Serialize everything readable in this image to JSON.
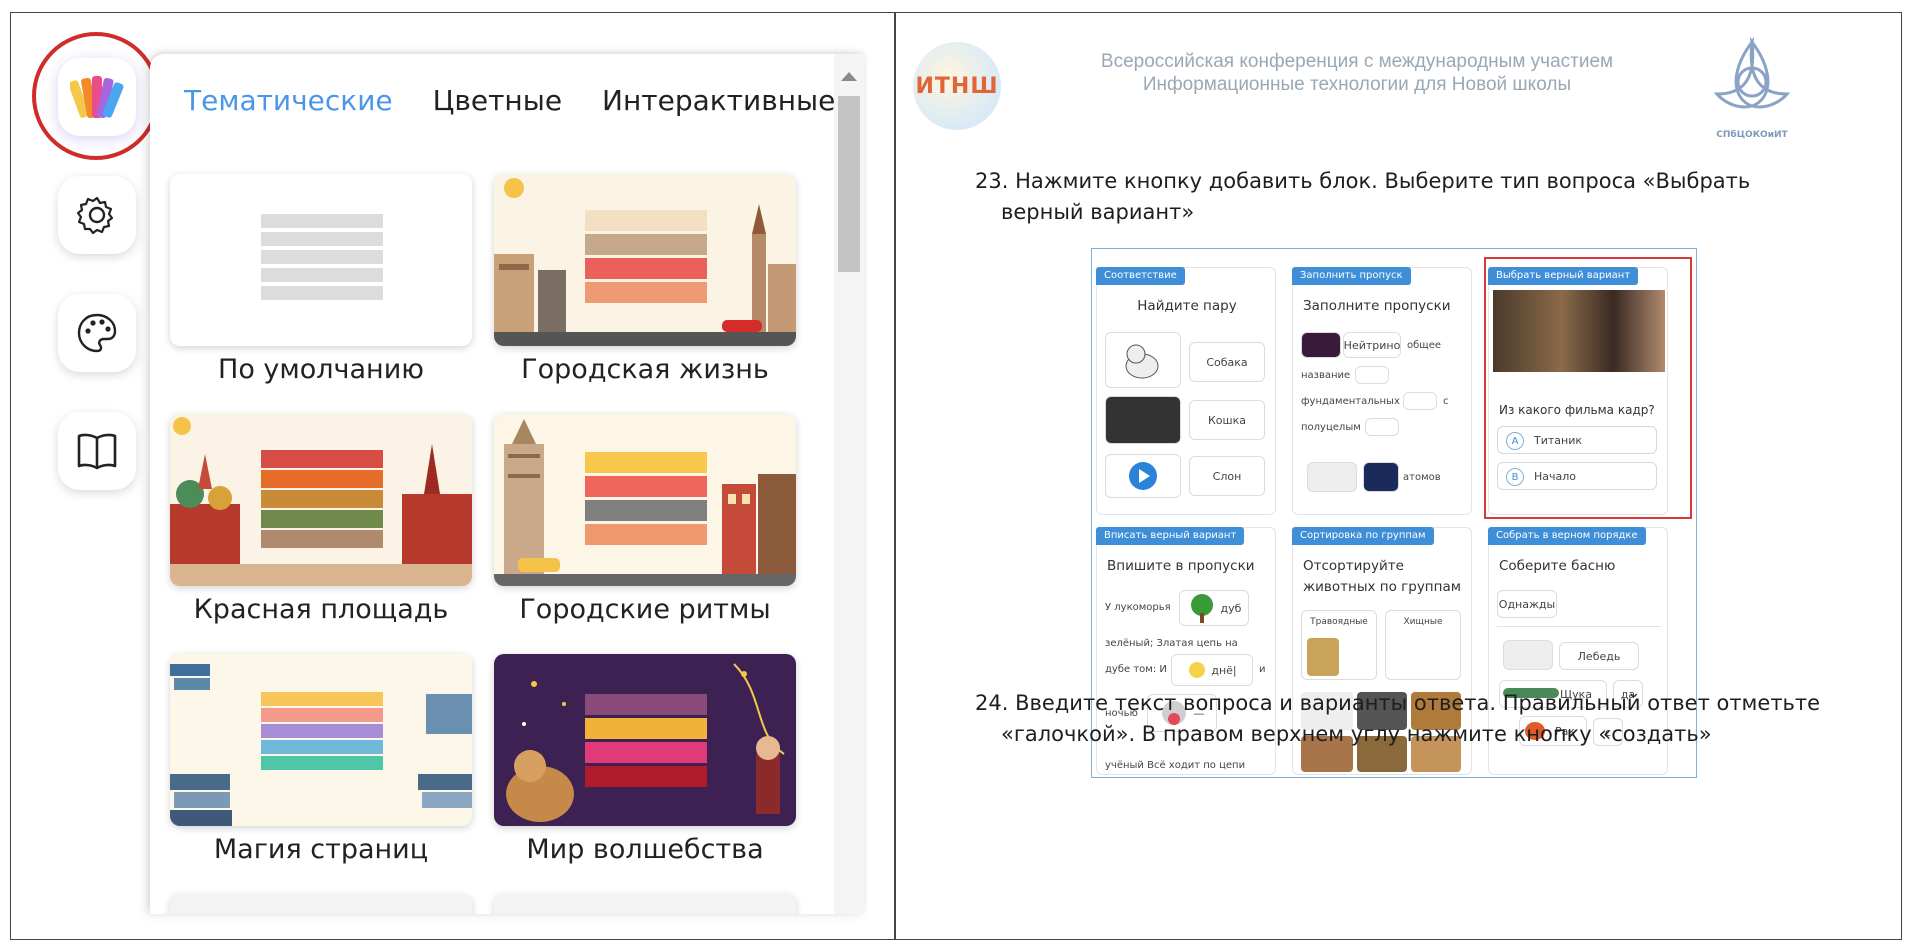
{
  "left": {
    "tabs": [
      {
        "label": "Тематические",
        "active": true
      },
      {
        "label": "Цветные",
        "active": false
      },
      {
        "label": "Интерактивные",
        "active": false
      }
    ],
    "sidebar": [
      {
        "icon": "palette-swatches-icon",
        "active": true
      },
      {
        "icon": "gear-icon",
        "active": false
      },
      {
        "icon": "paint-palette-icon",
        "active": false
      },
      {
        "icon": "open-book-icon",
        "active": false
      }
    ],
    "themes": [
      {
        "label": "По умолчанию",
        "bg": "#ffffff",
        "stripes": [
          "#dcdcdc",
          "#dcdcdc",
          "#dcdcdc",
          "#dcdcdc",
          "#dcdcdc"
        ]
      },
      {
        "label": "Городская жизнь",
        "bg": "#fbf4e4",
        "stripes": [
          "#f2dfc4",
          "#c6a98a",
          "#e9615a",
          "#ee9a74"
        ]
      },
      {
        "label": "Красная площадь",
        "bg": "#fbf3e6",
        "stripes": [
          "#d64d46",
          "#e66c2a",
          "#c98a3a",
          "#6f8a4a",
          "#b08a6e"
        ]
      },
      {
        "label": "Городские ритмы",
        "bg": "#fdf5e6",
        "stripes": [
          "#f7c84b",
          "#ee665c",
          "#808080",
          "#ef9a6e"
        ]
      },
      {
        "label": "Магия страниц",
        "bg": "#fdf7ea",
        "stripes": [
          "#f7c55a",
          "#f39a8a",
          "#a58ed6",
          "#6fb8d9",
          "#4fc6a6"
        ]
      },
      {
        "label": "Мир волшебства",
        "bg": "#3d2152",
        "stripes": [
          "#8a4a7a",
          "#f2b23a",
          "#e03a7a",
          "#b01a2a"
        ]
      }
    ]
  },
  "right": {
    "logo_left": "ИТНШ",
    "conference": [
      "Всероссийская конференция с международным участием",
      "Информационные технологии для Новой школы"
    ],
    "logo_right_caption": "СПбЦОКОиИТ",
    "step23": [
      "23. Нажмите кнопку добавить блок. Выберите тип вопроса «Выбрать",
      "верный вариант»"
    ],
    "step24": [
      "24. Введите текст вопроса и варианты ответа. Правильный ответ отметьте",
      "«галочкой». В правом верхнем углу нажмите кнопку «создать»"
    ],
    "screenshot": {
      "blocks": [
        {
          "tag": "Соответствие",
          "title": "Найдите пару",
          "items": [
            "Собака",
            "Кошка",
            "Слон"
          ]
        },
        {
          "tag": "Заполнить пропуск",
          "title": "Заполните пропуски",
          "items": [
            "Нейтрино",
            "общее",
            "название",
            "фундаментальных",
            "с",
            "полуцелым",
            "атомов"
          ]
        },
        {
          "tag": "Выбрать верный вариант",
          "title": "Из какого фильма кадр?",
          "options": [
            {
              "letter": "A",
              "text": "Титаник"
            },
            {
              "letter": "B",
              "text": "Начало"
            }
          ]
        },
        {
          "tag": "Вписать верный вариант",
          "title": "Впишите в пропуски",
          "items": [
            "У лукоморья",
            "дуб",
            "зелёный; Златая цепь на",
            "дубе том: И",
            "днё|",
            "и",
            "ночью",
            "—",
            "учёный Всё ходит по цепи"
          ]
        },
        {
          "tag": "Сортировка по группам",
          "title": "Отсортируйте животных по группам",
          "groups": [
            "Травоядные",
            "Хищные"
          ]
        },
        {
          "tag": "Собрать в верном порядке",
          "title": "Соберите басню",
          "items": [
            "Однажды",
            "Лебедь",
            "Щука",
            "да",
            "Рак",
            "с"
          ]
        }
      ]
    }
  }
}
